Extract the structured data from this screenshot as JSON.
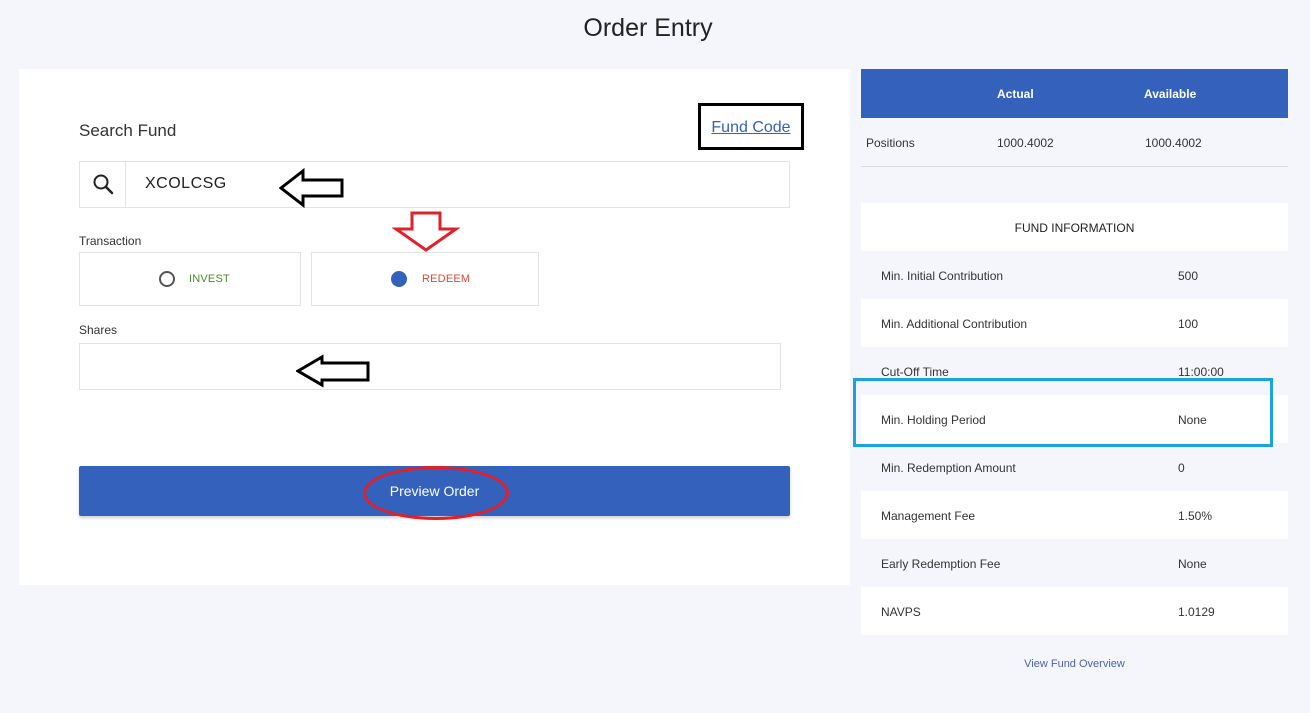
{
  "page": {
    "title": "Order Entry"
  },
  "order_form": {
    "search_label": "Search Fund",
    "fund_code_link": "Fund Code",
    "search_value": "XCOLCSG",
    "transaction_label": "Transaction",
    "options": [
      {
        "label": "INVEST",
        "selected": false,
        "color": "#4a8a2a"
      },
      {
        "label": "REDEEM",
        "selected": true,
        "color": "#d94b36"
      }
    ],
    "shares_label": "Shares",
    "shares_value": "",
    "preview_button": "Preview Order"
  },
  "positions": {
    "headers": [
      "",
      "Actual",
      "Available"
    ],
    "row": {
      "label": "Positions",
      "actual": "1000.4002",
      "available": "1000.4002"
    }
  },
  "fund_info": {
    "title": "FUND INFORMATION",
    "rows": [
      {
        "label": "Min. Initial Contribution",
        "value": "500"
      },
      {
        "label": "Min. Additional Contribution",
        "value": "100"
      },
      {
        "label": "Cut-Off Time",
        "value": "11:00:00"
      },
      {
        "label": "Min. Holding Period",
        "value": "None"
      },
      {
        "label": "Min. Redemption Amount",
        "value": "0"
      },
      {
        "label": "Management Fee",
        "value": "1.50%"
      },
      {
        "label": "Early Redemption Fee",
        "value": "None"
      },
      {
        "label": "NAVPS",
        "value": "1.0129"
      }
    ],
    "overview_link": "View Fund Overview"
  },
  "colors": {
    "primary": "#3461bb",
    "background": "#f5f6fb",
    "annotation_red": "#e0202a",
    "annotation_blue": "#1aa3de"
  }
}
